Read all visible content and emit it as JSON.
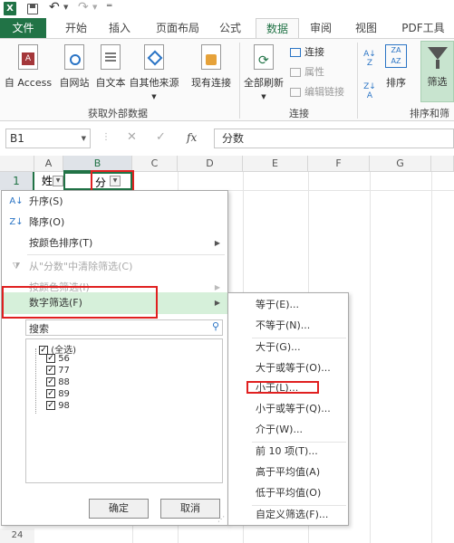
{
  "tabs": [
    "文件",
    "开始",
    "插入",
    "页面布局",
    "公式",
    "数据",
    "审阅",
    "视图",
    "PDF工具"
  ],
  "ribbon": {
    "buttons": [
      "自 Access",
      "自网站",
      "自文本",
      "自其他来源",
      "现有连接",
      "全部刷新",
      "连接",
      "属性",
      "编辑链接",
      "排序",
      "筛选"
    ],
    "groups": [
      "获取外部数据",
      "连接",
      "排序和筛"
    ]
  },
  "formula": {
    "cell_ref": "B1",
    "fx": "fx",
    "value": "分数"
  },
  "columns": [
    "A",
    "B",
    "C",
    "D",
    "E",
    "F",
    "G"
  ],
  "rows": {
    "r1": "1",
    "r24": "24"
  },
  "cells": {
    "a1": "姓",
    "b1": "分"
  },
  "menu": {
    "sort_asc": "升序(S)",
    "sort_desc": "降序(O)",
    "sort_color": "按颜色排序(T)",
    "clear_filter": "从\"分数\"中清除筛选(C)",
    "filter_color": "按颜色筛选(I)",
    "number_filter": "数字筛选(F)",
    "search_placeholder": "搜索",
    "checks": [
      "(全选)",
      "56",
      "77",
      "88",
      "89",
      "98"
    ],
    "ok": "确定",
    "cancel": "取消"
  },
  "submenu": [
    "等于(E)...",
    "不等于(N)...",
    "大于(G)...",
    "大于或等于(O)...",
    "小于(L)...",
    "小于或等于(Q)...",
    "介于(W)...",
    "前 10 项(T)...",
    "高于平均值(A)",
    "低于平均值(O)",
    "自定义筛选(F)..."
  ],
  "colors": {
    "excel_green": "#217346",
    "active_tab": "#217346",
    "highlight_red": "#e02020",
    "menu_hover": "#d6f0da"
  }
}
